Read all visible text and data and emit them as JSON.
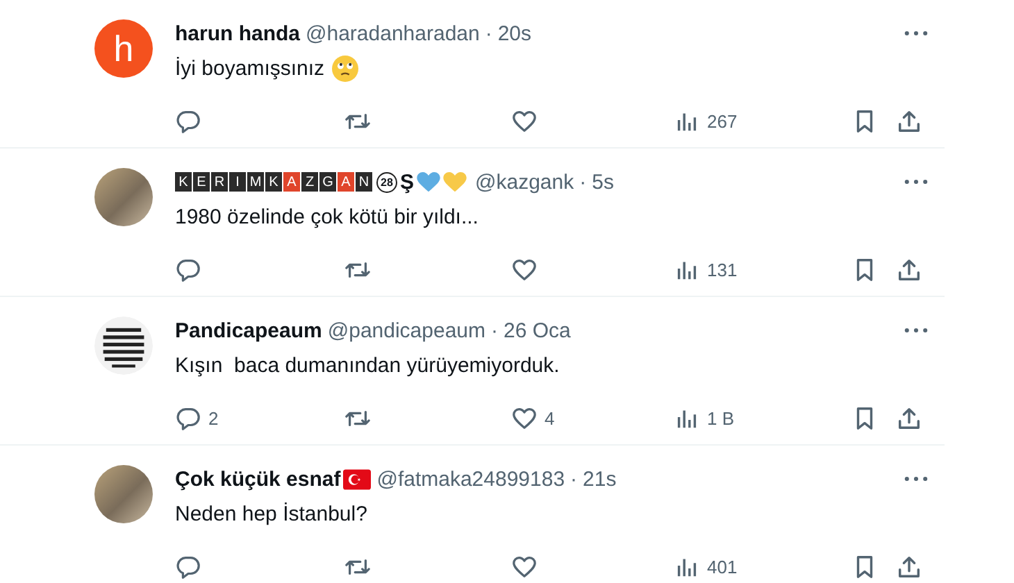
{
  "replies": [
    {
      "avatar": {
        "kind": "letter",
        "letter": "h"
      },
      "name": "harun handa",
      "handle": "@haradanharadan",
      "separator": "·",
      "time": "20s",
      "text": "İyi boyamışsınız",
      "text_emoji": {
        "kind": "face"
      },
      "views": "267"
    },
    {
      "avatar": {
        "kind": "photo"
      },
      "name_tiles": [
        {
          "letter": "K",
          "kind": "dark"
        },
        {
          "letter": "E",
          "kind": "dark"
        },
        {
          "letter": "R",
          "kind": "dark"
        },
        {
          "letter": "I",
          "kind": "dark"
        },
        {
          "letter": "M",
          "kind": "dark"
        },
        {
          "letter": "K",
          "kind": "dark"
        },
        {
          "letter": "A",
          "kind": "red"
        },
        {
          "letter": "Z",
          "kind": "dark"
        },
        {
          "letter": "G",
          "kind": "dark"
        },
        {
          "letter": "A",
          "kind": "red"
        },
        {
          "letter": "N",
          "kind": "dark"
        }
      ],
      "badge": "28",
      "name_tail": "Ş",
      "hearts": [
        {
          "color": "#5dade2"
        },
        {
          "color": "#f7c948"
        }
      ],
      "handle": "@kazgank",
      "separator": "·",
      "time": "5s",
      "text": "1980 özelinde çok kötü bir yıldı...",
      "views": "131"
    },
    {
      "avatar": {
        "kind": "logo"
      },
      "name": "Pandicapeaum",
      "handle": "@pandicapeaum",
      "separator": "·",
      "time": "26 Oca",
      "text": "Kışın  baca dumanından yürüyemiyorduk.",
      "reply_count": "2",
      "like_count": "4",
      "views": "1 B"
    },
    {
      "avatar": {
        "kind": "photo"
      },
      "name": "Çok küçük esnaf",
      "flag": {
        "kind": "turkey"
      },
      "handle": "@fatmaka24899183",
      "separator": "·",
      "time": "21s",
      "text": "Neden hep İstanbul?",
      "views": "401"
    }
  ]
}
